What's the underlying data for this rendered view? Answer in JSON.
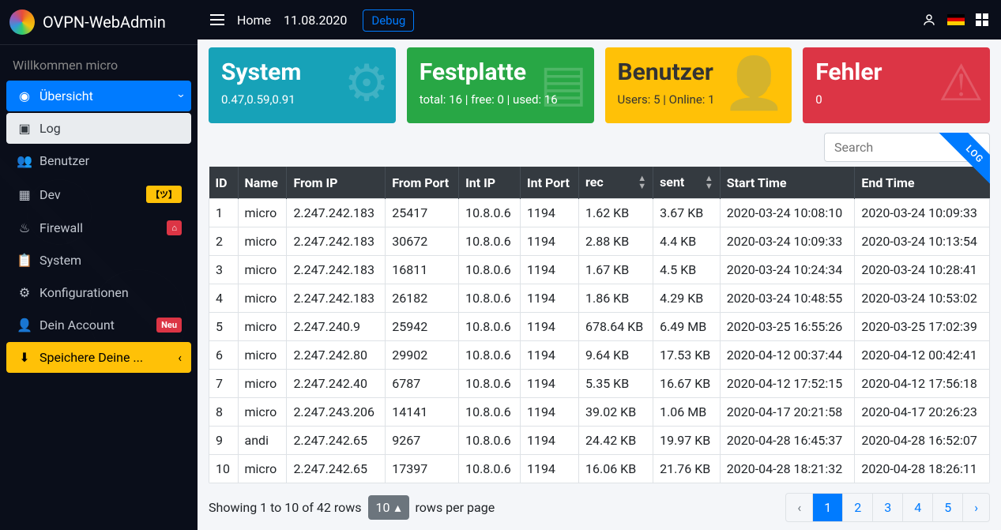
{
  "brand": "OVPN-WebAdmin",
  "welcome": "Willkommen micro",
  "topbar": {
    "home": "Home",
    "date": "11.08.2020",
    "debug": "Debug"
  },
  "sidebar": {
    "items": [
      {
        "label": "Übersicht",
        "icon": "dashboard",
        "active": true,
        "caret": true
      },
      {
        "label": "Log",
        "icon": "book",
        "sub": true
      },
      {
        "label": "Benutzer",
        "icon": "users"
      },
      {
        "label": "Dev",
        "icon": "boxes",
        "badge": "【ツ】",
        "badgeClass": "badge-yellow"
      },
      {
        "label": "Firewall",
        "icon": "fire",
        "badge": "⌂",
        "badgeClass": "badge-red"
      },
      {
        "label": "System",
        "icon": "clipboard"
      },
      {
        "label": "Konfigurationen",
        "icon": "cogs"
      },
      {
        "label": "Dein Account",
        "icon": "user",
        "badge": "Neu",
        "badgeClass": "badge-neu"
      },
      {
        "label": "Speichere Deine ...",
        "icon": "download",
        "save": true,
        "caret_left": true
      }
    ]
  },
  "cards": {
    "system": {
      "title": "System",
      "sub": "0.47,0.59,0.91"
    },
    "disk": {
      "title": "Festplatte",
      "sub": "total: 16 | free: 0 | used: 16"
    },
    "users": {
      "title": "Benutzer",
      "sub": "Users: 5 | Online: 1"
    },
    "errors": {
      "title": "Fehler",
      "sub": "0"
    }
  },
  "search": {
    "placeholder": "Search",
    "ribbon": "LOG"
  },
  "table": {
    "headers": [
      "ID",
      "Name",
      "From IP",
      "From Port",
      "Int IP",
      "Int Port",
      "rec",
      "sent",
      "Start Time",
      "End Time"
    ],
    "rows": [
      [
        "1",
        "micro",
        "2.247.242.183",
        "25417",
        "10.8.0.6",
        "1194",
        "1.62 KB",
        "3.67 KB",
        "2020-03-24 10:08:10",
        "2020-03-24 10:09:33"
      ],
      [
        "2",
        "micro",
        "2.247.242.183",
        "30672",
        "10.8.0.6",
        "1194",
        "2.88 KB",
        "4.4 KB",
        "2020-03-24 10:09:33",
        "2020-03-24 10:13:54"
      ],
      [
        "3",
        "micro",
        "2.247.242.183",
        "16811",
        "10.8.0.6",
        "1194",
        "1.67 KB",
        "4.5 KB",
        "2020-03-24 10:24:34",
        "2020-03-24 10:28:41"
      ],
      [
        "4",
        "micro",
        "2.247.242.183",
        "26182",
        "10.8.0.6",
        "1194",
        "1.86 KB",
        "4.29 KB",
        "2020-03-24 10:48:55",
        "2020-03-24 10:53:02"
      ],
      [
        "5",
        "micro",
        "2.247.240.9",
        "25942",
        "10.8.0.6",
        "1194",
        "678.64 KB",
        "6.49 MB",
        "2020-03-25 16:55:26",
        "2020-03-25 17:02:39"
      ],
      [
        "6",
        "micro",
        "2.247.242.80",
        "29902",
        "10.8.0.6",
        "1194",
        "9.64 KB",
        "17.53 KB",
        "2020-04-12 00:37:44",
        "2020-04-12 00:42:41"
      ],
      [
        "7",
        "micro",
        "2.247.242.40",
        "6787",
        "10.8.0.6",
        "1194",
        "5.35 KB",
        "16.67 KB",
        "2020-04-12 17:52:15",
        "2020-04-12 17:56:18"
      ],
      [
        "8",
        "micro",
        "2.247.243.206",
        "14141",
        "10.8.0.6",
        "1194",
        "39.02 KB",
        "1.06 MB",
        "2020-04-17 20:21:58",
        "2020-04-17 20:26:23"
      ],
      [
        "9",
        "andi",
        "2.247.242.65",
        "9267",
        "10.8.0.6",
        "1194",
        "24.42 KB",
        "19.97 KB",
        "2020-04-28 16:45:37",
        "2020-04-28 16:52:07"
      ],
      [
        "10",
        "micro",
        "2.247.242.65",
        "17397",
        "10.8.0.6",
        "1194",
        "16.06 KB",
        "21.76 KB",
        "2020-04-28 18:21:32",
        "2020-04-28 18:26:11"
      ]
    ]
  },
  "pager": {
    "showing": "Showing 1 to 10 of 42 rows",
    "rpp": "10",
    "rpp_suffix": "rows per page",
    "pages": [
      "‹",
      "1",
      "2",
      "3",
      "4",
      "5",
      "›"
    ],
    "active": 1
  }
}
